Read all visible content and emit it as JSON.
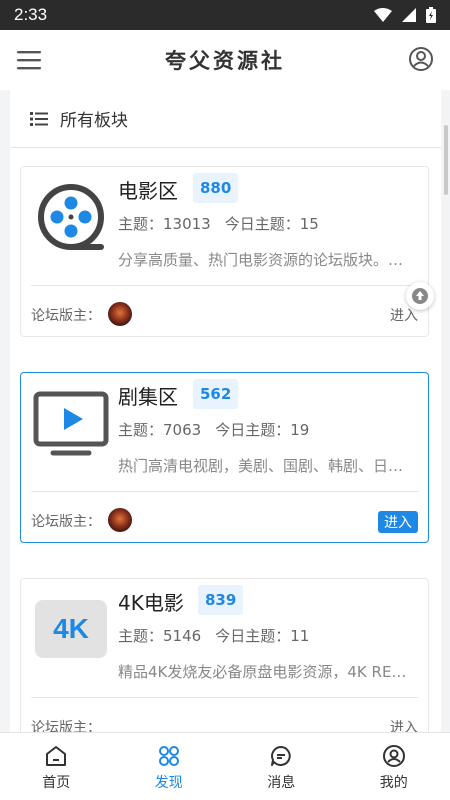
{
  "status_bar": {
    "time": "2:33"
  },
  "app_bar": {
    "title": "夸父资源社"
  },
  "section": {
    "title": "所有板块"
  },
  "boards": [
    {
      "name": "电影区",
      "post_count": "880",
      "topics_label": "主题：13013",
      "today_label": "今日主题：15",
      "description": "分享高质量、热门电影资源的论坛版块。…",
      "moderator_label": "论坛版主：",
      "enter_label": "进入",
      "icon": "film-reel-icon"
    },
    {
      "name": "剧集区",
      "post_count": "562",
      "topics_label": "主题：7063",
      "today_label": "今日主题：19",
      "description": "热门高清电视剧，美剧、国剧、韩剧、日…",
      "moderator_label": "论坛版主：",
      "enter_label": "进入",
      "icon": "tv-play-icon"
    },
    {
      "name": "4K电影",
      "post_count": "839",
      "topics_label": "主题：5146",
      "today_label": "今日主题：11",
      "description": "精品4K发烧友必备原盘电影资源，4K RE…",
      "moderator_label": "论坛版主：",
      "enter_label": "进入",
      "icon_text": "4K",
      "icon": "4k-icon"
    }
  ],
  "tabs": [
    {
      "label": "首页",
      "icon": "home-icon"
    },
    {
      "label": "发现",
      "icon": "discover-grid-icon"
    },
    {
      "label": "消息",
      "icon": "message-icon"
    },
    {
      "label": "我的",
      "icon": "profile-icon"
    }
  ],
  "colors": {
    "accent": "#1e88e5",
    "status_bar": "#2b2b2b",
    "badge_bg": "#e8f3fd"
  }
}
